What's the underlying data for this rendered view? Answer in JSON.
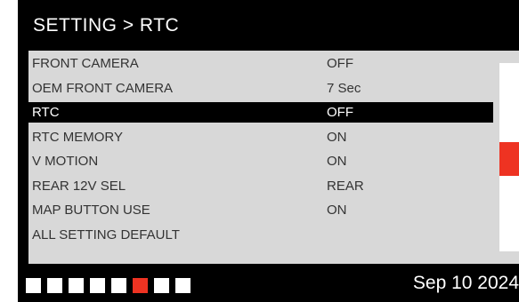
{
  "header": {
    "title": "SETTING > RTC"
  },
  "menu": {
    "items": [
      {
        "label": "FRONT CAMERA",
        "value": "OFF"
      },
      {
        "label": "OEM FRONT CAMERA",
        "value": "7 Sec"
      },
      {
        "label": "RTC",
        "value": "OFF",
        "selected": true
      },
      {
        "label": "RTC MEMORY",
        "value": "ON"
      },
      {
        "label": "V MOTION",
        "value": "ON"
      },
      {
        "label": "REAR 12V SEL",
        "value": "REAR"
      },
      {
        "label": "MAP BUTTON USE",
        "value": "ON"
      },
      {
        "label": "ALL SETTING DEFAULT",
        "value": ""
      }
    ],
    "scroll_position": 0.45
  },
  "pager": {
    "total_pages": 8,
    "current_page": 6
  },
  "footer": {
    "date": "Sep 10 2024"
  },
  "colors": {
    "background": "#000000",
    "panel": "#d8d8d8",
    "highlight": "#000000",
    "accent": "#ee3322",
    "indicator": "#ffffff"
  }
}
